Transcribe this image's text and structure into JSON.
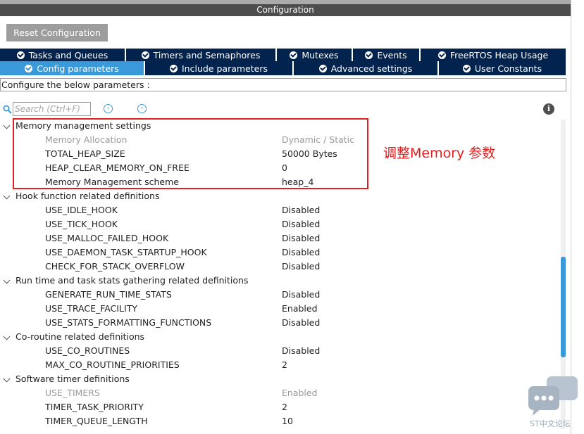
{
  "window": {
    "title": "Configuration"
  },
  "toolbar": {
    "reset_label": "Reset Configuration"
  },
  "tabs_row1": [
    {
      "label": "Tasks and Queues"
    },
    {
      "label": "Timers and Semaphores"
    },
    {
      "label": "Mutexes"
    },
    {
      "label": "Events"
    },
    {
      "label": "FreeRTOS Heap Usage"
    }
  ],
  "tabs_row2": [
    {
      "label": "Config parameters",
      "active": true
    },
    {
      "label": "Include parameters"
    },
    {
      "label": "Advanced settings"
    },
    {
      "label": "User Constants"
    }
  ],
  "description": "Configure the below parameters :",
  "search": {
    "placeholder": "Search (Ctrl+F)"
  },
  "icons": {
    "search": "magnifier-icon",
    "prev": "chevron-left-circle-icon",
    "next": "chevron-right-circle-icon",
    "info": "info-icon",
    "group_toggle": "chevron-down-icon"
  },
  "colors": {
    "tab_bg": "#02234e",
    "tab_active": "#3a9ad9",
    "annotation": "#e02020",
    "title_bar": "#4d4d4d"
  },
  "groups": [
    {
      "name": "Memory management settings",
      "params": [
        {
          "name": "Memory Allocation",
          "value": "Dynamic / Static",
          "disabled": true
        },
        {
          "name": "TOTAL_HEAP_SIZE",
          "value": "50000 Bytes"
        },
        {
          "name": "HEAP_CLEAR_MEMORY_ON_FREE",
          "value": "0"
        },
        {
          "name": "Memory Management scheme",
          "value": "heap_4"
        }
      ]
    },
    {
      "name": "Hook function related definitions",
      "params": [
        {
          "name": "USE_IDLE_HOOK",
          "value": "Disabled"
        },
        {
          "name": "USE_TICK_HOOK",
          "value": "Disabled"
        },
        {
          "name": "USE_MALLOC_FAILED_HOOK",
          "value": "Disabled"
        },
        {
          "name": "USE_DAEMON_TASK_STARTUP_HOOK",
          "value": "Disabled"
        },
        {
          "name": "CHECK_FOR_STACK_OVERFLOW",
          "value": "Disabled"
        }
      ]
    },
    {
      "name": "Run time and task stats gathering related definitions",
      "params": [
        {
          "name": "GENERATE_RUN_TIME_STATS",
          "value": "Disabled"
        },
        {
          "name": "USE_TRACE_FACILITY",
          "value": "Enabled"
        },
        {
          "name": "USE_STATS_FORMATTING_FUNCTIONS",
          "value": "Disabled"
        }
      ]
    },
    {
      "name": "Co-routine related definitions",
      "params": [
        {
          "name": "USE_CO_ROUTINES",
          "value": "Disabled"
        },
        {
          "name": "MAX_CO_ROUTINE_PRIORITIES",
          "value": "2"
        }
      ]
    },
    {
      "name": "Software timer definitions",
      "params": [
        {
          "name": "USE_TIMERS",
          "value": "Enabled",
          "disabled": true
        },
        {
          "name": "TIMER_TASK_PRIORITY",
          "value": "2"
        },
        {
          "name": "TIMER_QUEUE_LENGTH",
          "value": "10"
        }
      ]
    }
  ],
  "annotation": "调整Memory 参数",
  "watermark": "ST中文论坛"
}
